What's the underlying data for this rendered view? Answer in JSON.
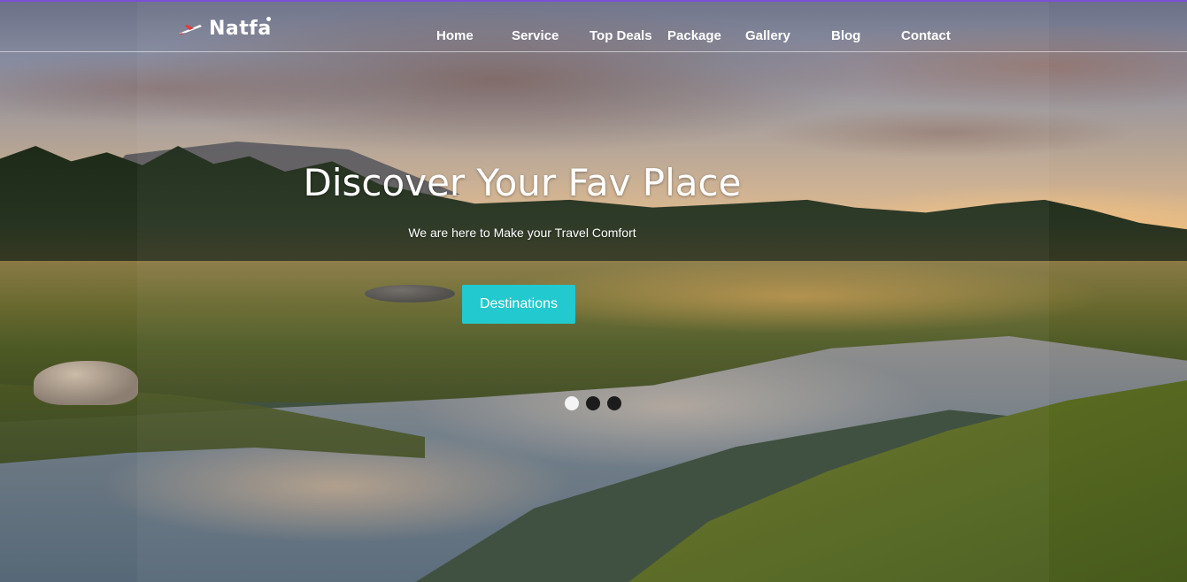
{
  "brand": {
    "name": "Natfa"
  },
  "nav": {
    "items": [
      {
        "label": "Home"
      },
      {
        "label": "Service"
      },
      {
        "label": "Top Deals"
      },
      {
        "label": "Package"
      },
      {
        "label": "Gallery"
      },
      {
        "label": "Blog"
      },
      {
        "label": "Contact"
      }
    ]
  },
  "hero": {
    "title": "Discover Your Fav Place",
    "subtitle": "We are here to Make your Travel Comfort",
    "cta_label": "Destinations",
    "slides_total": 3,
    "active_slide": 1
  },
  "colors": {
    "accent": "#22c9cf",
    "top_bar": "#7b4fd6",
    "text": "#ffffff"
  },
  "icons": {
    "logo": "airplane-icon"
  }
}
